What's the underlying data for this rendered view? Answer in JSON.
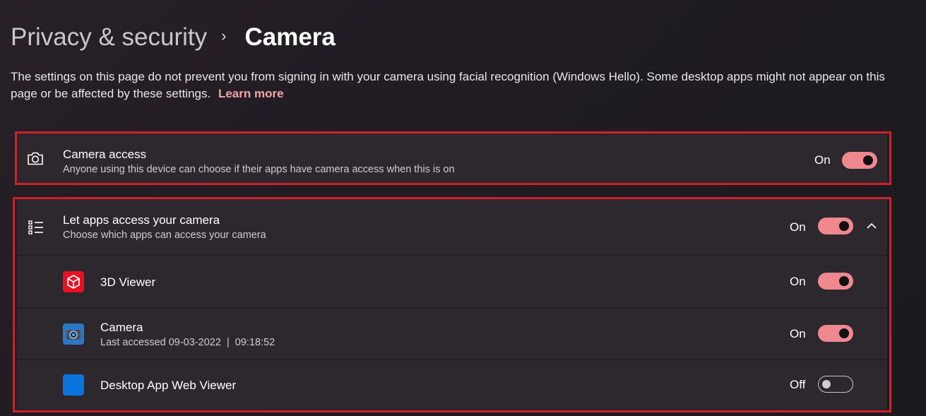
{
  "header": {
    "parent": "Privacy & security",
    "separator": "›",
    "current": "Camera"
  },
  "description": {
    "text": "The settings on this page do not prevent you from signing in with your camera using facial recognition (Windows Hello). Some desktop apps might not appear on this page or be affected by these settings.",
    "link": "Learn more"
  },
  "camera_access": {
    "icon": "camera-icon",
    "title": "Camera access",
    "subtitle": "Anyone using this device can choose if their apps have camera access when this is on",
    "state": "On",
    "enabled": true
  },
  "apps_access": {
    "icon": "list-icon",
    "title": "Let apps access your camera",
    "subtitle": "Choose which apps can access your camera",
    "state": "On",
    "enabled": true,
    "expanded": true,
    "apps": [
      {
        "name": "3D Viewer",
        "icon": "3d-viewer-icon",
        "subtitle": "",
        "state": "On",
        "enabled": true
      },
      {
        "name": "Camera",
        "icon": "camera-app-icon",
        "subtitle": "Last accessed 09-03-2022  |  09:18:52",
        "state": "On",
        "enabled": true
      },
      {
        "name": "Desktop App Web Viewer",
        "icon": "desktop-app-web-viewer-icon",
        "subtitle": "",
        "state": "Off",
        "enabled": false
      }
    ]
  },
  "colors": {
    "accent": "#f0888f",
    "highlight_outline": "#d11f2b",
    "link": "#f4a3ab"
  }
}
